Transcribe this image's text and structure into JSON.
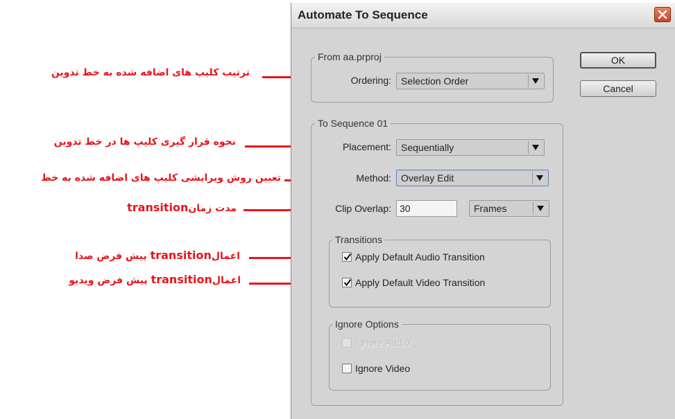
{
  "annotations": {
    "ordering": "ترتیب کلیپ های اضافه شده به خط تدوین",
    "placement": "نحوه قرار گیری کلیپ ها در خط تدوین",
    "method": "تعیین روش ویرایشی کلیپ های اضافه شده به خط",
    "overlap_pre": "مدت زمان",
    "overlap_en": "transition",
    "audio_pre": "اعمال",
    "audio_en": "transition",
    "audio_post": "پیش فرض صدا",
    "video_pre": "اعمال",
    "video_en": "transition",
    "video_post": "پیش فرض ویدیو",
    "color": "#e8141a"
  },
  "dialog": {
    "title": "Automate To Sequence",
    "ok_label": "OK",
    "cancel_label": "Cancel",
    "from_group": {
      "legend": "From aa.prproj",
      "ordering_label": "Ordering:",
      "ordering_value": "Selection Order"
    },
    "to_group": {
      "legend": "To Sequence 01",
      "placement_label": "Placement:",
      "placement_value": "Sequentially",
      "method_label": "Method:",
      "method_value": "Overlay Edit",
      "clip_overlap_label": "Clip Overlap:",
      "clip_overlap_value": "30",
      "clip_overlap_unit": "Frames"
    },
    "transitions_group": {
      "legend": "Transitions",
      "audio_label": "Apply Default Audio Transition",
      "audio_checked": true,
      "video_label": "Apply Default Video Transition",
      "video_checked": true
    },
    "ignore_group": {
      "legend": "Ignore Options",
      "ignore_audio_label": "Ignore Audio",
      "ignore_audio_enabled": false,
      "ignore_video_label": "Ignore Video",
      "ignore_video_checked": false
    }
  }
}
